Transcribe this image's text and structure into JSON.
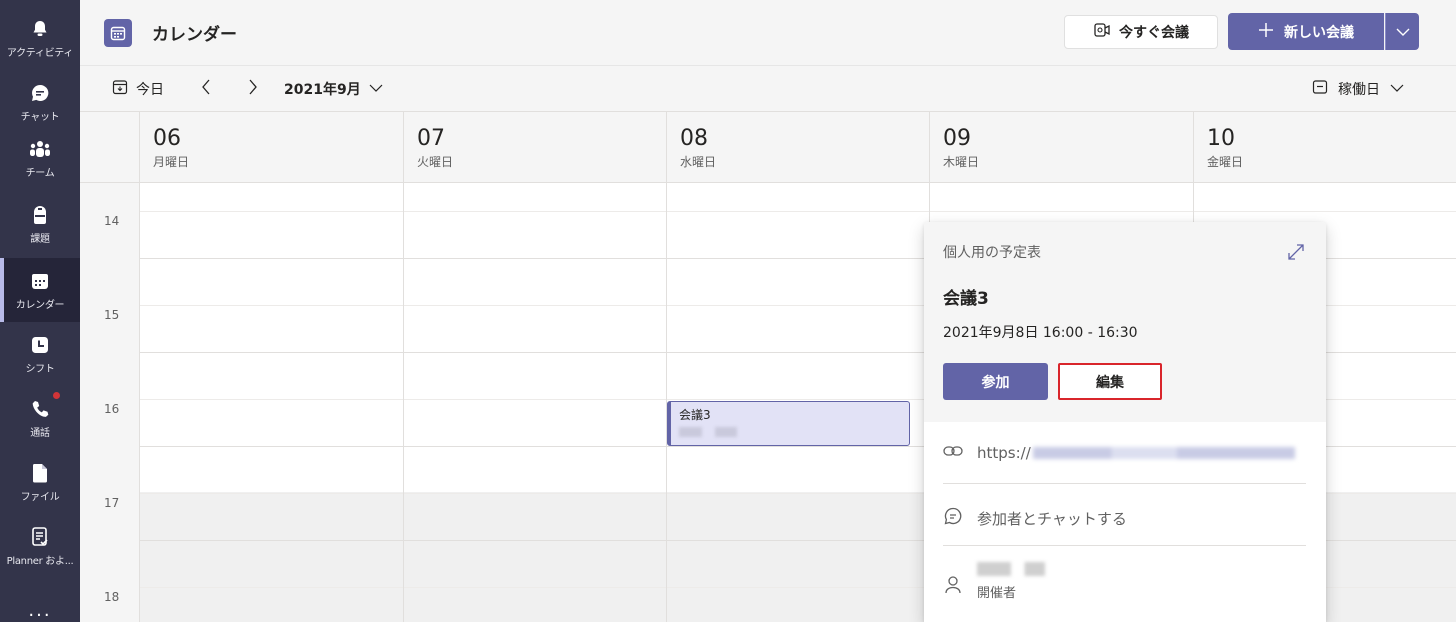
{
  "app": {
    "title": "カレンダー",
    "accent": "#6264a7"
  },
  "rail": {
    "items": [
      {
        "label": "アクティビティ",
        "icon": "bell-icon"
      },
      {
        "label": "チャット",
        "icon": "chat-icon"
      },
      {
        "label": "チーム",
        "icon": "teams-icon"
      },
      {
        "label": "課題",
        "icon": "backpack-icon"
      },
      {
        "label": "カレンダー",
        "icon": "calendar-icon",
        "active": true
      },
      {
        "label": "シフト",
        "icon": "clock-icon"
      },
      {
        "label": "通話",
        "icon": "phone-icon",
        "badge": true
      },
      {
        "label": "ファイル",
        "icon": "file-icon"
      },
      {
        "label": "Planner およ...",
        "icon": "planner-icon"
      }
    ],
    "more_label": "..."
  },
  "header": {
    "meet_now_label": "今すぐ会議",
    "new_meeting_label": "新しい会議"
  },
  "toolbar": {
    "today_label": "今日",
    "month_label": "2021年9月",
    "view_label": "稼働日"
  },
  "days": [
    {
      "num": "06",
      "name": "月曜日"
    },
    {
      "num": "07",
      "name": "火曜日"
    },
    {
      "num": "08",
      "name": "水曜日"
    },
    {
      "num": "09",
      "name": "木曜日"
    },
    {
      "num": "10",
      "name": "金曜日"
    }
  ],
  "hours": [
    "14",
    "15",
    "16",
    "17",
    "18"
  ],
  "event": {
    "title": "会議3"
  },
  "popup": {
    "calendar_name": "個人用の予定表",
    "title": "会議3",
    "datetime": "2021年9月8日 16:00 - 16:30",
    "join_label": "参加",
    "edit_label": "編集",
    "link_prefix": "https://",
    "chat_label": "参加者とチャットする",
    "organizer_role": "開催者"
  }
}
